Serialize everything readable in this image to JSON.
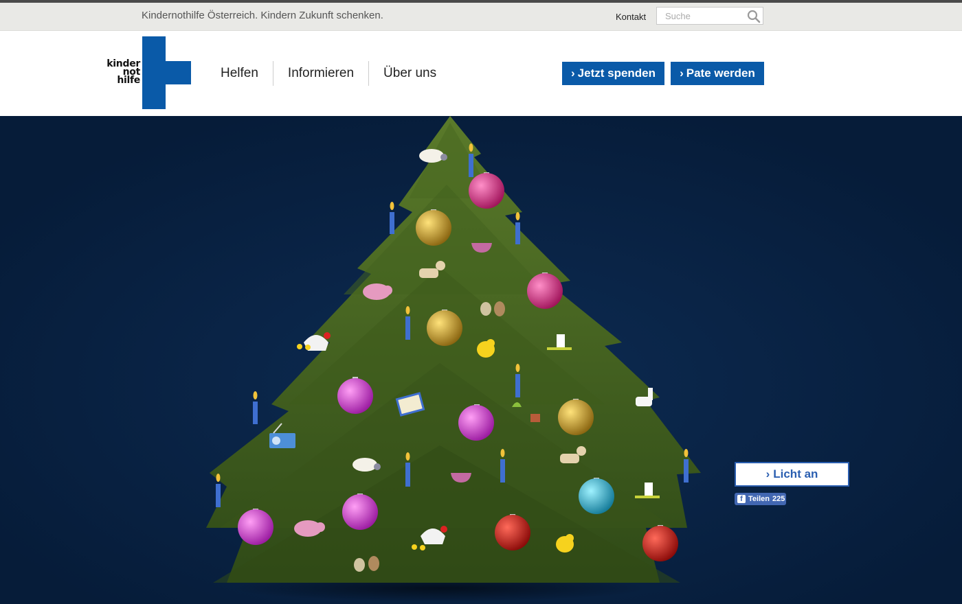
{
  "topbar": {
    "tagline": "Kindernothilfe Österreich. Kindern Zukunft schenken.",
    "kontakt": "Kontakt",
    "search_placeholder": "Suche"
  },
  "logo": {
    "line1": "kinder",
    "line2": "not",
    "line3": "hilfe"
  },
  "nav": {
    "items": [
      "Helfen",
      "Informieren",
      "Über uns"
    ]
  },
  "cta": {
    "spenden": "Jetzt spenden",
    "pate": "Pate werden"
  },
  "stage": {
    "licht_label": "Licht an",
    "share_label": "Teilen",
    "share_count": "225"
  },
  "colors": {
    "brand_blue": "#0a5aa8",
    "night_sky": "#082345",
    "tree_green": "#3d5a1e"
  },
  "icons": [
    "search-icon",
    "chevron-right-icon",
    "facebook-icon"
  ]
}
